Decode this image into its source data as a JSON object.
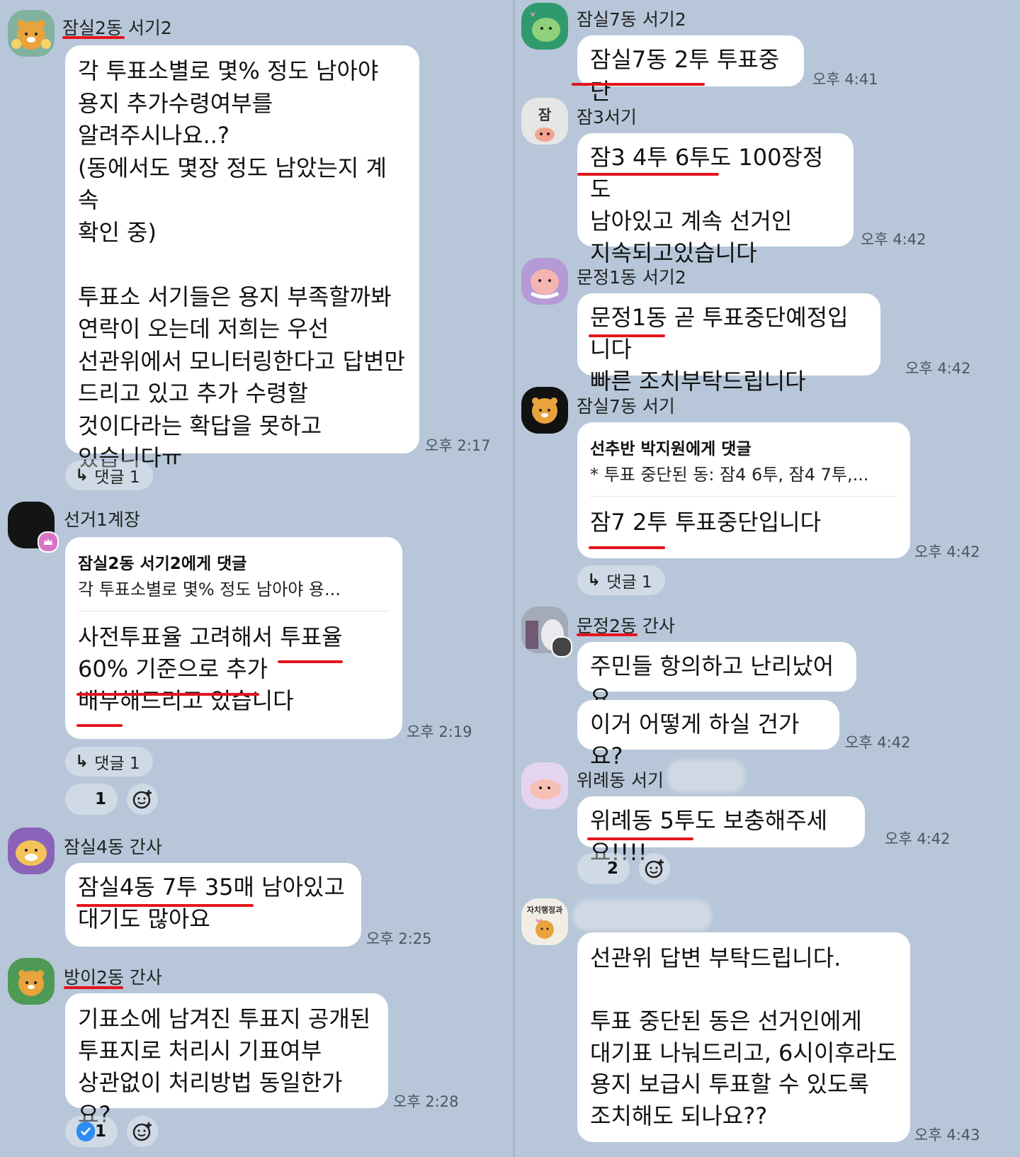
{
  "colors": {
    "background": "#b7c7d9",
    "bubble": "#ffffff",
    "underline": "#e4151c",
    "badge": "#ffffff"
  },
  "left": {
    "m1": {
      "sender": "잠실2동 서기2",
      "text": "각 투표소별로 몇% 정도 남아야\n용지 추가수령여부를\n알려주시나요..?\n(동에서도 몇장 정도 남았는지 계속\n확인 중)\n\n투표소 서기들은 용지 부족할까봐\n연락이 오는데 저희는 우선\n선관위에서 모니터링한다고 답변만\n드리고 있고 추가 수령할\n것이다라는 확답을 못하고\n있습니다ㅠ",
      "time": "오후 2:17",
      "replies": "댓글 1",
      "avatar_icon": "ryan-cheer-icon"
    },
    "m2": {
      "sender": "선거1계장",
      "reply_to": "잠실2동 서기2에게 댓글",
      "quote": "각 투표소별로 몇% 정도 남아야  용...",
      "text": "사전투표율 고려해서 투표율\n60% 기준으로 추가\n배부해드리고 있습니다",
      "time": "오후 2:19",
      "replies": "댓글 1",
      "reaction_count": "1",
      "avatar_icon": "black-avatar-icon"
    },
    "m3": {
      "sender": "잠실4동 간사",
      "text": "잠실4동 7투 35매 남아있고\n대기도 많아요",
      "time": "오후 2:25",
      "avatar_icon": "character-purple-icon"
    },
    "m4": {
      "sender": "방이2동 간사",
      "text": "기표소에 남겨진 투표지 공개된\n투표지로 처리시 기표여부\n상관없이 처리방법 동일한가요?",
      "time": "오후 2:28",
      "reaction_count": "1",
      "avatar_icon": "ryan-green-icon"
    }
  },
  "right": {
    "m1": {
      "sender": "잠실7동 서기2",
      "text": "잠실7동 2투 투표중단",
      "time": "오후 4:41",
      "avatar_icon": "leaf-character-icon"
    },
    "m2": {
      "sender": "잠3서기",
      "avatar_letter": "잠",
      "text": "잠3 4투 6투도 100장정도\n남아있고 계속 선거인\n지속되고있습니다",
      "time": "오후 4:42",
      "avatar_icon": "apeach-letter-icon"
    },
    "m3": {
      "sender": "문정1동 서기2",
      "text": "문정1동 곧 투표중단예정입니다\n빠른 조치부탁드립니다",
      "time": "오후 4:42",
      "avatar_icon": "apeach-crying-icon"
    },
    "m4": {
      "sender": "잠실7동 서기",
      "reply_to": "선추반 박지원에게 댓글",
      "quote": "* 투표 중단된 동: 잠4 6투, 잠4 7투,...",
      "text": "잠7 2투 투표중단입니다",
      "time": "오후 4:42",
      "replies": "댓글 1",
      "avatar_icon": "ryan-black-icon"
    },
    "m5": {
      "sender": "문정2동 간사",
      "text1": "주민들 항의하고 난리났어요",
      "text2": "이거 어떻게 하실 건가요?",
      "time": "오후 4:42",
      "avatar_icon": "photo-avatar-icon"
    },
    "m6": {
      "sender": "위례동 서기",
      "text": "위례동 5투도 보충해주세요!!!!",
      "time": "오후 4:42",
      "reaction_count": "2",
      "avatar_icon": "apeach-lying-icon"
    },
    "m7": {
      "avatar_label": "자치행정과",
      "text": "선관위 답변 부탁드립니다.\n\n투표 중단된 동은 선거인에게\n대기표 나눠드리고, 6시이후라도\n용지 보급시 투표할 수 있도록\n조치해도 되나요??",
      "time": "오후 4:43",
      "avatar_icon": "ryan-admin-icon"
    }
  }
}
